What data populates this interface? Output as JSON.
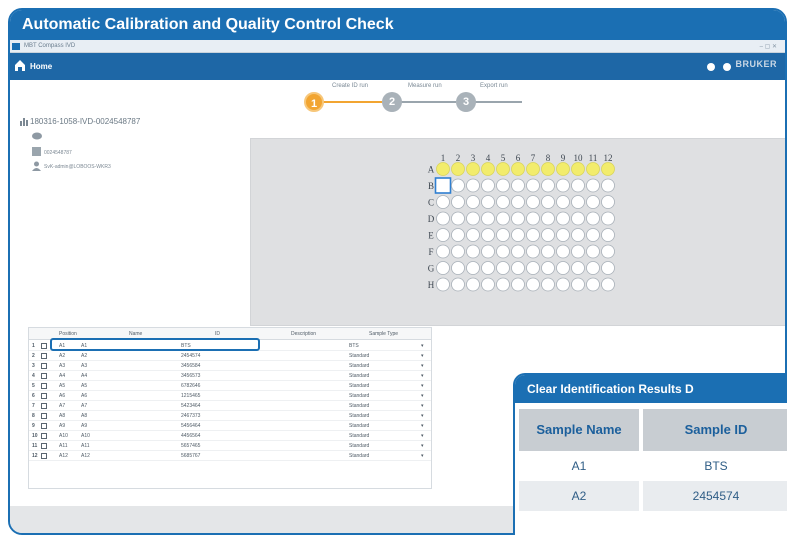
{
  "banner": {
    "title": "Automatic Calibration and Quality Control Check"
  },
  "app": {
    "window_title": "MBT Compass IVD",
    "window_controls": "– ▢ ✕",
    "home_label": "Home",
    "brand_logo": "BRUKER"
  },
  "steps": [
    {
      "number": "1",
      "label": "Create ID run",
      "active": true
    },
    {
      "number": "2",
      "label": "Measure run",
      "active": false
    },
    {
      "number": "3",
      "label": "Export run",
      "active": false
    }
  ],
  "run": {
    "id": "180316-1058-IVD-0024548787",
    "target": "0024548787",
    "user": "SvK-admin@LOBOOS-WKR3"
  },
  "plate": {
    "columns": [
      "1",
      "2",
      "3",
      "4",
      "5",
      "6",
      "7",
      "8",
      "9",
      "10",
      "11",
      "12"
    ],
    "rows": [
      "A",
      "B",
      "C",
      "D",
      "E",
      "F",
      "G",
      "H"
    ],
    "filled_row": "A",
    "selected_cell": "B1",
    "fill_color": "#f2ec6c",
    "empty_color": "#ffffff",
    "select_color": "#2f7fd0"
  },
  "grid": {
    "headers": {
      "index": "",
      "check": "",
      "position": "Position",
      "name": "Name",
      "id": "ID",
      "description": "Description",
      "sample_type": "Sample Type"
    },
    "rows": [
      {
        "n": "1",
        "pos": "A1",
        "name": "A1",
        "id": "BTS",
        "type": "BTS"
      },
      {
        "n": "2",
        "pos": "A2",
        "name": "A2",
        "id": "2454574",
        "type": "Standard"
      },
      {
        "n": "3",
        "pos": "A3",
        "name": "A3",
        "id": "3456584",
        "type": "Standard"
      },
      {
        "n": "4",
        "pos": "A4",
        "name": "A4",
        "id": "3456573",
        "type": "Standard"
      },
      {
        "n": "5",
        "pos": "A5",
        "name": "A5",
        "id": "6782646",
        "type": "Standard"
      },
      {
        "n": "6",
        "pos": "A6",
        "name": "A6",
        "id": "1215465",
        "type": "Standard"
      },
      {
        "n": "7",
        "pos": "A7",
        "name": "A7",
        "id": "5423464",
        "type": "Standard"
      },
      {
        "n": "8",
        "pos": "A8",
        "name": "A8",
        "id": "2467373",
        "type": "Standard"
      },
      {
        "n": "9",
        "pos": "A9",
        "name": "A9",
        "id": "5456464",
        "type": "Standard"
      },
      {
        "n": "10",
        "pos": "A10",
        "name": "A10",
        "id": "4456564",
        "type": "Standard"
      },
      {
        "n": "11",
        "pos": "A11",
        "name": "A11",
        "id": "5657465",
        "type": "Standard"
      },
      {
        "n": "12",
        "pos": "A12",
        "name": "A12",
        "id": "5685767",
        "type": "Standard"
      }
    ],
    "dropdown_glyph": "▾"
  },
  "callout": {
    "title": "Clear Identification Results D",
    "col1": "Sample Name",
    "col2": "Sample ID",
    "rows": [
      {
        "name": "A1",
        "id": "BTS"
      },
      {
        "name": "A2",
        "id": "2454574"
      }
    ]
  }
}
